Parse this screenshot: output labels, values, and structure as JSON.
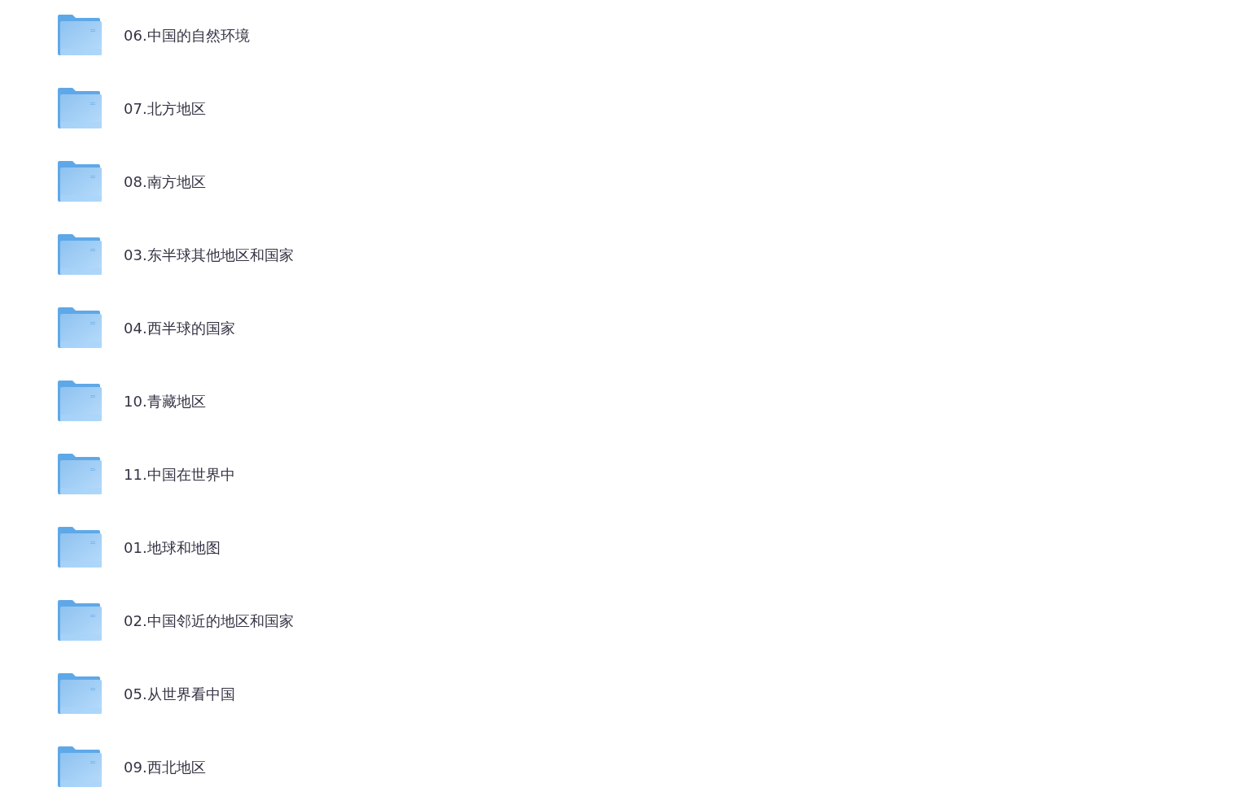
{
  "folders": [
    {
      "name": "06.中国的自然环境"
    },
    {
      "name": "07.北方地区"
    },
    {
      "name": "08.南方地区"
    },
    {
      "name": "03.东半球其他地区和国家"
    },
    {
      "name": "04.西半球的国家"
    },
    {
      "name": "10.青藏地区"
    },
    {
      "name": "11.中国在世界中"
    },
    {
      "name": "01.地球和地图"
    },
    {
      "name": "02.中国邻近的地区和国家"
    },
    {
      "name": "05.从世界看中国"
    },
    {
      "name": "09.西北地区"
    }
  ]
}
